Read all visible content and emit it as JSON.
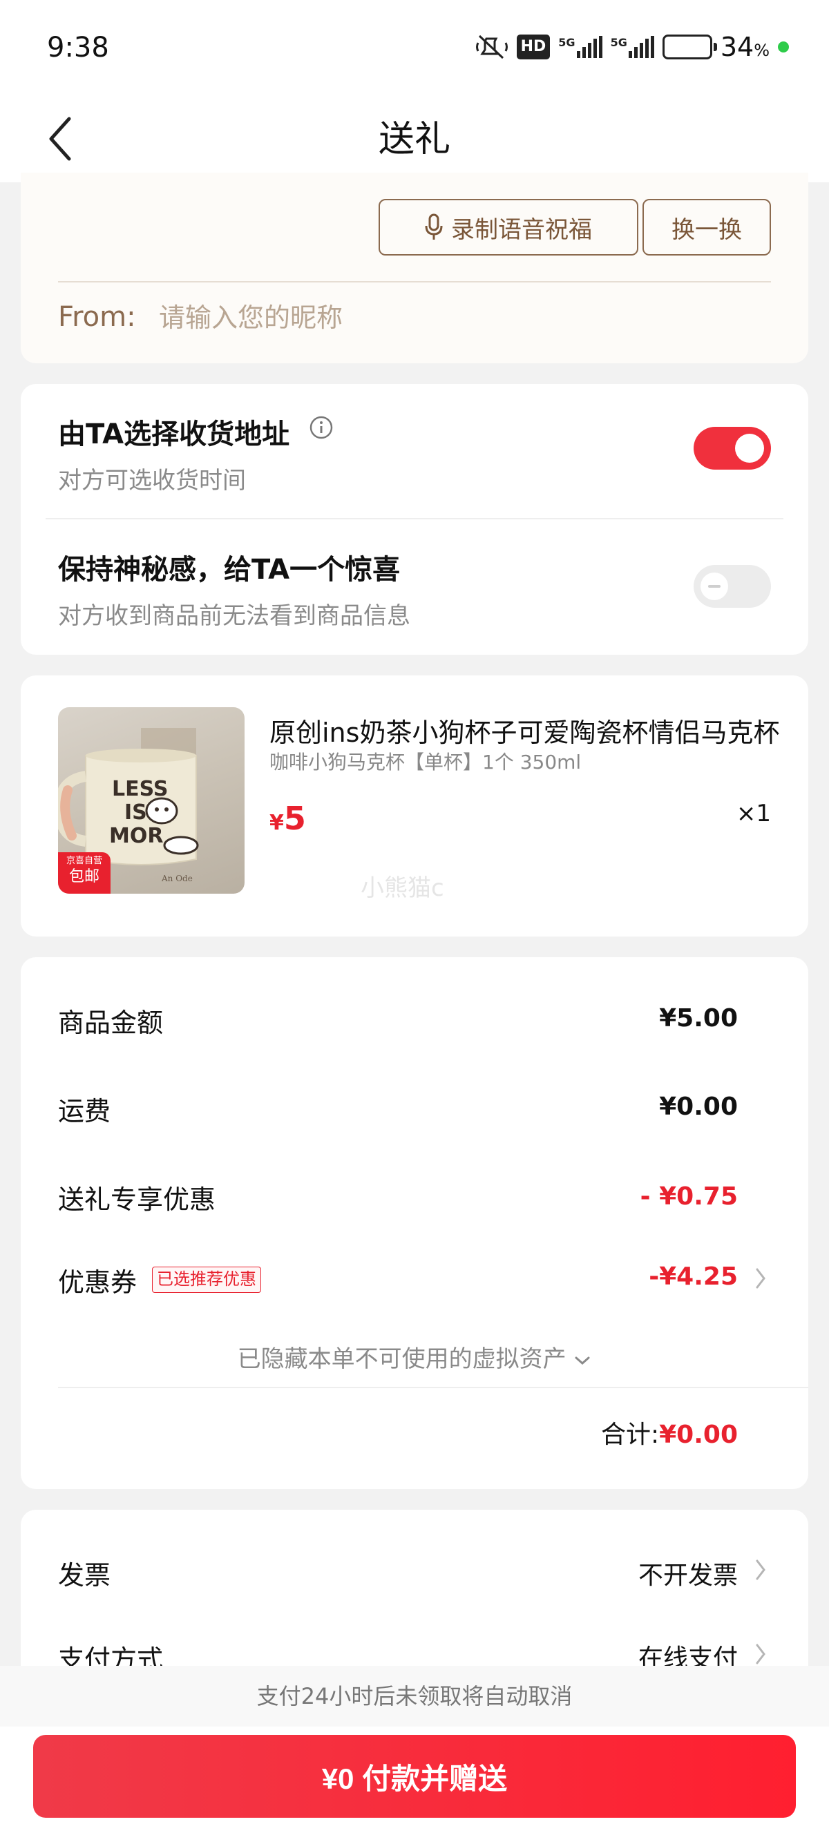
{
  "status_bar": {
    "time": "9:38",
    "hd_label": "HD",
    "signal1_label": "5G",
    "signal2_label": "5G",
    "battery_percent": "34",
    "battery_unit": "%",
    "battery_level": 0.34
  },
  "navbar": {
    "title": "送礼",
    "back_icon": "chevron-left-icon"
  },
  "blessing": {
    "record_label": "录制语音祝福",
    "change_label": "换一换",
    "from_label": "From:",
    "from_placeholder": "请输入您的昵称",
    "from_value": ""
  },
  "options": {
    "address": {
      "title": "由TA选择收货地址",
      "subtitle": "对方可选收货时间",
      "enabled": true
    },
    "surprise": {
      "title": "保持神秘感，给TA一个惊喜",
      "subtitle": "对方收到商品前无法看到商品信息",
      "enabled": false
    }
  },
  "product": {
    "title": "原创ins奶茶小狗杯子可爱陶瓷杯情侣马克杯",
    "spec": "咖啡小狗马克杯【单杯】1个 350ml",
    "price_symbol": "¥",
    "price": "5",
    "quantity": "×1",
    "tag_line1": "京喜自营",
    "tag_line2": "包邮",
    "watermark": "小熊猫c"
  },
  "amounts": {
    "goods_label": "商品金额",
    "goods_value": "¥5.00",
    "shipping_label": "运费",
    "shipping_value": "¥0.00",
    "gift_discount_label": "送礼专享优惠",
    "gift_discount_value": "- ¥0.75",
    "coupon_label": "优惠券",
    "coupon_badge": "已选推荐优惠",
    "coupon_value": "-¥4.25",
    "hidden_assets": "已隐藏本单不可使用的虚拟资产",
    "total_label": "合计:",
    "total_value": "¥0.00"
  },
  "payment": {
    "invoice_label": "发票",
    "invoice_value": "不开发票",
    "method_label": "支付方式",
    "method_value": "在线支付"
  },
  "bottom": {
    "notice": "支付24小时后未领取将自动取消",
    "pay_button": "¥0 付款并赠送"
  },
  "colors": {
    "accent": "#f0303d",
    "price_red": "#e8212e",
    "brown": "#8b6a4f",
    "battery_dot": "#2ecc4a"
  }
}
